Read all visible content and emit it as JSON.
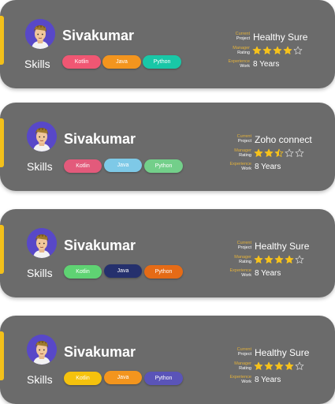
{
  "profiles": [
    {
      "name": "Sivakumar",
      "skills_label": "Skills",
      "skills": [
        {
          "label": "Kotlin",
          "color": "#f05773"
        },
        {
          "label": "Java",
          "color": "#f3951e"
        },
        {
          "label": "Python",
          "color": "#19c7a7"
        }
      ],
      "current_project_label_1": "Current",
      "current_project_label_2": "Project",
      "current_project": "Healthy Sure",
      "manager_rating_label_1": "Manager",
      "manager_rating_label_2": "Rating",
      "rating": 4,
      "rating_max": 5,
      "experience_label_1": "Experience",
      "experience_label_2": "Work",
      "experience": "8 Years"
    },
    {
      "name": "Sivakumar",
      "skills_label": "Skills",
      "skills": [
        {
          "label": "Kotlin",
          "color": "#e35a7b"
        },
        {
          "label": "Java",
          "color": "#7ec9e7"
        },
        {
          "label": "Python",
          "color": "#73cf8a"
        }
      ],
      "current_project_label_1": "Current",
      "current_project_label_2": "Project",
      "current_project": "Zoho connect",
      "manager_rating_label_1": "Manager",
      "manager_rating_label_2": "Rating",
      "rating": 2.5,
      "rating_max": 5,
      "experience_label_1": "Experience",
      "experience_label_2": "Work",
      "experience": "8 Years"
    },
    {
      "name": "Sivakumar",
      "skills_label": "Skills",
      "skills": [
        {
          "label": "Kotlin",
          "color": "#5fd373"
        },
        {
          "label": "Java",
          "color": "#25306d"
        },
        {
          "label": "Python",
          "color": "#e56b16"
        }
      ],
      "current_project_label_1": "Current",
      "current_project_label_2": "Project",
      "current_project": "Healthy Sure",
      "manager_rating_label_1": "Manager",
      "manager_rating_label_2": "Rating",
      "rating": 4,
      "rating_max": 5,
      "experience_label_1": "Experience",
      "experience_label_2": "Work",
      "experience": "8 Years"
    },
    {
      "name": "Sivakumar",
      "skills_label": "Skills",
      "skills": [
        {
          "label": "Kotlin",
          "color": "#f5c20d"
        },
        {
          "label": "Java",
          "color": "#f3951e"
        },
        {
          "label": "Python",
          "color": "#5a54b8"
        }
      ],
      "current_project_label_1": "Current",
      "current_project_label_2": "Project",
      "current_project": "Healthy Sure",
      "manager_rating_label_1": "Manager",
      "manager_rating_label_2": "Rating",
      "rating": 4,
      "rating_max": 5,
      "experience_label_1": "Experience",
      "experience_label_2": "Work",
      "experience": "8 Years"
    }
  ],
  "colors": {
    "card_bg": "#6b6b6b",
    "accent_bar": "#f3c01a",
    "label_orange": "#e4b23a",
    "star_fill": "#f7c21b",
    "avatar_bg": "#5848c8"
  }
}
